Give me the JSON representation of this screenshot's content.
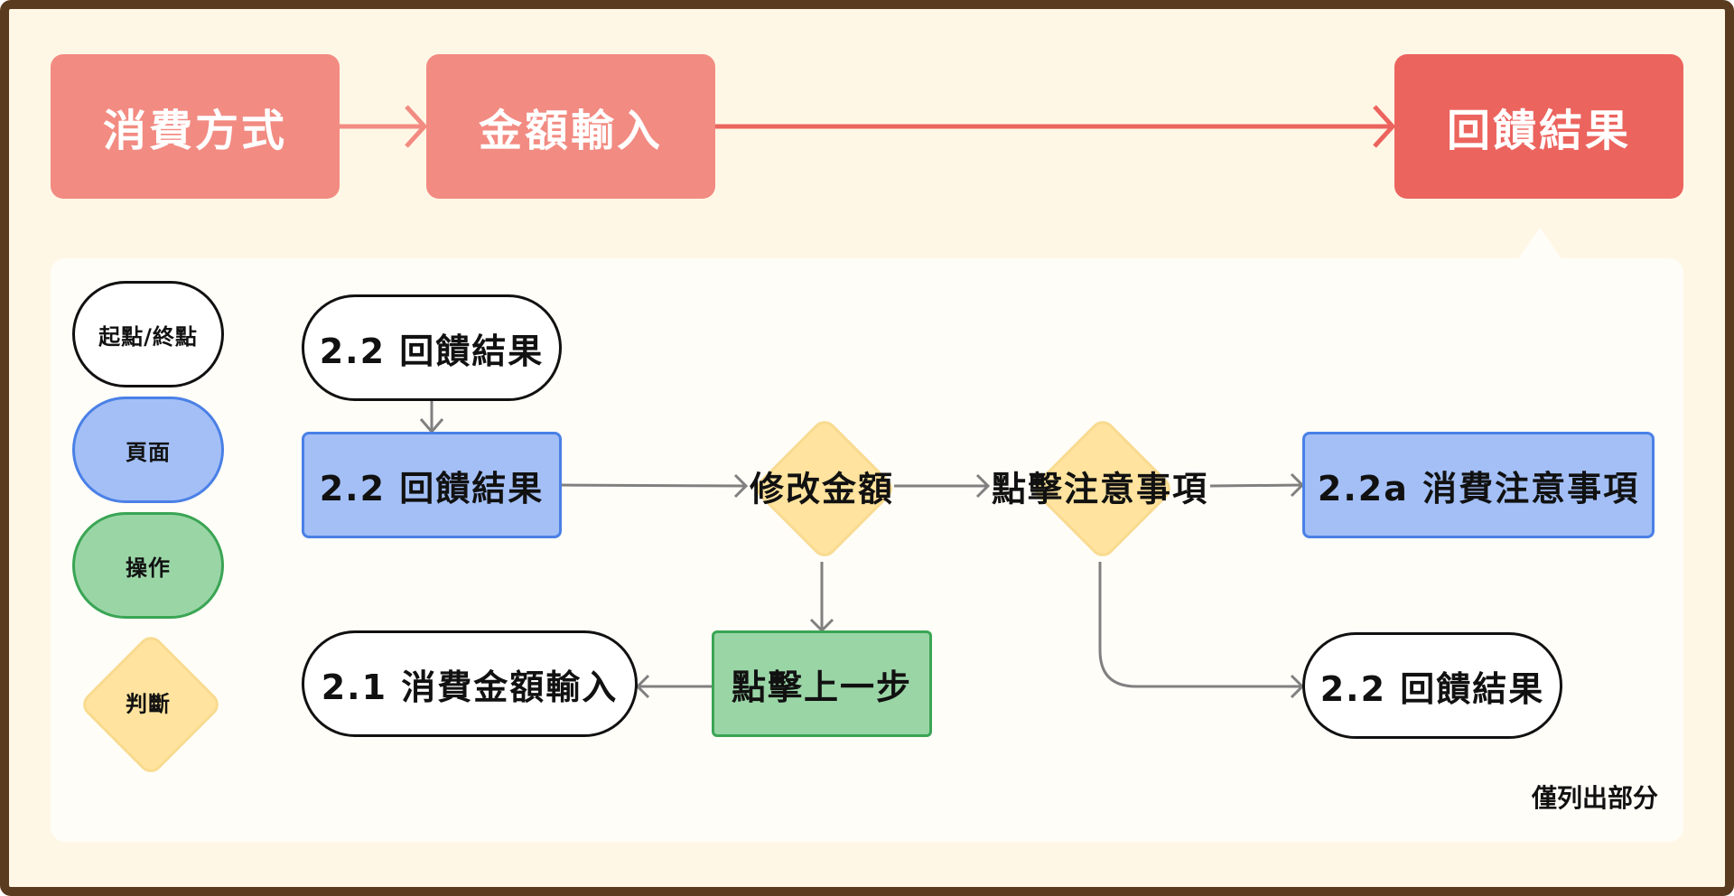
{
  "header_steps": [
    {
      "label": "消費方式",
      "color": "#f28b82"
    },
    {
      "label": "金額輸入",
      "color": "#f28b82"
    },
    {
      "label": "回饋結果",
      "color": "#ec645e"
    }
  ],
  "legend": {
    "start_end": "起點/終點",
    "page": "頁面",
    "action": "操作",
    "decision": "判斷"
  },
  "nodes": {
    "start_feedback": "2.2 回饋結果",
    "page_feedback": "2.2 回饋結果",
    "decision_edit_amount": "修改金額",
    "decision_view_notes": "點擊注意事項",
    "page_notes": "2.2a 消費注意事項",
    "action_back": "點擊上一步",
    "end_amount_input": "2.1 消費金額輸入",
    "end_feedback": "2.2 回饋結果"
  },
  "note": "僅列出部分"
}
